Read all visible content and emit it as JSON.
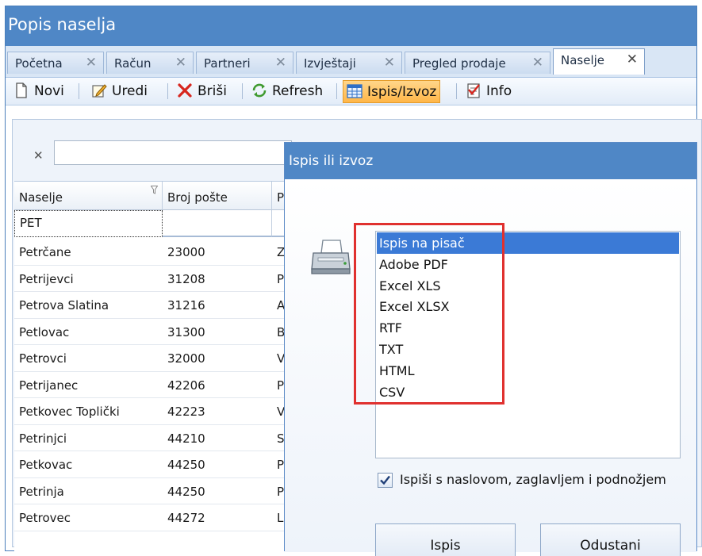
{
  "window": {
    "title": "Popis naselja"
  },
  "tabs": [
    {
      "label": "Početna",
      "active": false
    },
    {
      "label": "Račun",
      "active": false
    },
    {
      "label": "Partneri",
      "active": false
    },
    {
      "label": "Izvještaji",
      "active": false
    },
    {
      "label": "Pregled prodaje",
      "active": false
    },
    {
      "label": "Naselje",
      "active": true
    }
  ],
  "toolbar": {
    "novi": "Novi",
    "uredi": "Uredi",
    "brisi": "Briši",
    "refresh": "Refresh",
    "ispis_izvoz": "Ispis/Izvoz",
    "info": "Info"
  },
  "filter": {
    "clear_symbol": "✕",
    "value": ""
  },
  "grid": {
    "columns": [
      "Naselje",
      "Broj pošte",
      "P"
    ],
    "filter_values": [
      "PET",
      "",
      ""
    ],
    "rows": [
      [
        "Petrčane",
        "23000",
        "Z"
      ],
      [
        "Petrijevci",
        "31208",
        "P"
      ],
      [
        "Petrova Slatina",
        "31216",
        "A"
      ],
      [
        "Petlovac",
        "31300",
        "B"
      ],
      [
        "Petrovci",
        "32000",
        "V"
      ],
      [
        "Petrijanec",
        "42206",
        "P"
      ],
      [
        "Petkovec Toplički",
        "42223",
        "V"
      ],
      [
        "Petrinjci",
        "44210",
        "S"
      ],
      [
        "Petkovac",
        "44250",
        "P"
      ],
      [
        "Petrinja",
        "44250",
        "P"
      ],
      [
        "Petrovec",
        "44272",
        "L"
      ]
    ]
  },
  "dialog": {
    "title": "Ispis ili izvoz",
    "formats": [
      "Ispis na pisač",
      "Adobe PDF",
      "Excel XLS",
      "Excel XLSX",
      "RTF",
      "TXT",
      "HTML",
      "CSV"
    ],
    "selected_format": "Ispis na pisač",
    "checkbox_label": "Ispiši s naslovom, zaglavljem i podnožjem",
    "checkbox_checked": true,
    "btn_ispis": "Ispis",
    "btn_odustani": "Odustani"
  },
  "colors": {
    "titlebar": "#4f87c6",
    "selection": "#3b7ad6",
    "highlight": "#e0312f",
    "active_tool": "#ffb648"
  },
  "icons": {
    "novi": "new-document-icon",
    "uredi": "edit-icon",
    "brisi": "delete-x-icon",
    "refresh": "refresh-icon",
    "ispis_izvoz": "table-export-icon",
    "info": "info-checklist-icon",
    "dialog": "printer-icon"
  }
}
